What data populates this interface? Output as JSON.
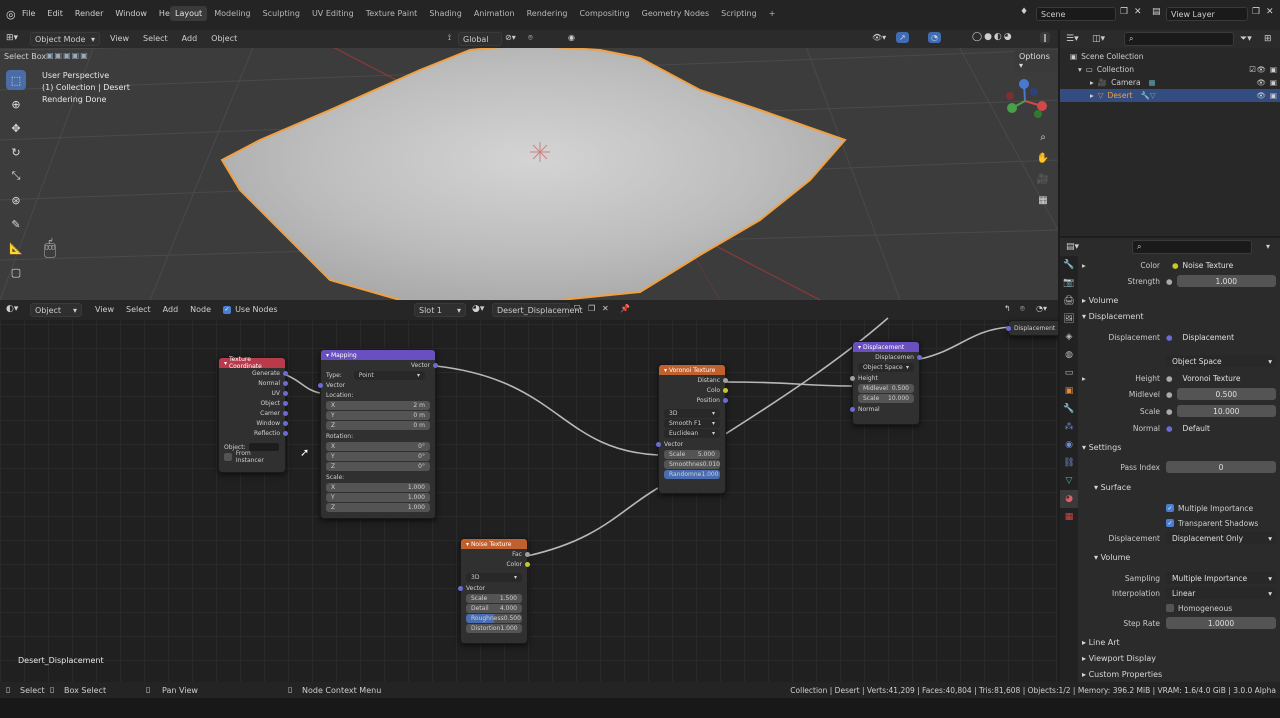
{
  "topbar": {
    "menus": [
      "File",
      "Edit",
      "Render",
      "Window",
      "Help"
    ],
    "workspaces": [
      "Layout",
      "Modeling",
      "Sculpting",
      "UV Editing",
      "Texture Paint",
      "Shading",
      "Animation",
      "Rendering",
      "Compositing",
      "Geometry Nodes",
      "Scripting"
    ],
    "active_workspace": "Layout",
    "scene": "Scene",
    "view_layer": "View Layer"
  },
  "viewport": {
    "select_box": "Select Box",
    "mode": "Object Mode",
    "menus": [
      "View",
      "Select",
      "Add",
      "Object"
    ],
    "transform": "Global",
    "options": "Options",
    "overlay_lines": [
      "User Perspective",
      "(1) Collection | Desert",
      "Rendering Done"
    ]
  },
  "node_editor": {
    "type": "Object",
    "menus": [
      "View",
      "Select",
      "Add",
      "Node"
    ],
    "use_nodes": "Use Nodes",
    "slot": "Slot 1",
    "material": "Desert_Displacement",
    "footer_label": "Desert_Displacement",
    "texture_coordinate": {
      "title": "Texture Coordinate",
      "outputs": [
        "Generate",
        "Normal",
        "UV",
        "Object",
        "Camer",
        "Window",
        "Reflectio"
      ],
      "object_label": "Object:",
      "from_instancer": "From Instancer"
    },
    "mapping": {
      "title": "Mapping",
      "output": "Vector",
      "type_label": "Type:",
      "type_value": "Point",
      "vector_label": "Vector",
      "location_label": "Location:",
      "location": [
        [
          "X",
          "2 m"
        ],
        [
          "Y",
          "0 m"
        ],
        [
          "Z",
          "0 m"
        ]
      ],
      "rotation_label": "Rotation:",
      "rotation": [
        [
          "X",
          "0°"
        ],
        [
          "Y",
          "0°"
        ],
        [
          "Z",
          "0°"
        ]
      ],
      "scale_label": "Scale:",
      "scale": [
        [
          "X",
          "1.000"
        ],
        [
          "Y",
          "1.000"
        ],
        [
          "Z",
          "1.000"
        ]
      ]
    },
    "voronoi": {
      "title": "Voronoi Texture",
      "outputs": [
        "Distanc",
        "Colo",
        "Position"
      ],
      "dims": "3D",
      "feature": "Smooth F1",
      "metric": "Euclidean",
      "vector_label": "Vector",
      "fields": [
        [
          "Scale",
          "5.000"
        ],
        [
          "Smoothnes",
          "0.010"
        ],
        [
          "Randomne",
          "1.000"
        ]
      ]
    },
    "noise": {
      "title": "Noise Texture",
      "outputs": [
        "Fac",
        "Color"
      ],
      "dims": "3D",
      "vector_label": "Vector",
      "fields": [
        [
          "Scale",
          "1.500"
        ],
        [
          "Detail",
          "4.000"
        ],
        [
          "Roughness",
          "0.500"
        ],
        [
          "Distortion",
          "1.000"
        ]
      ]
    },
    "displacement": {
      "title": "Displacement",
      "output": "Displacemen",
      "space": "Object Space",
      "inputs": [
        "Height"
      ],
      "fields": [
        [
          "Midlevel",
          "0.500"
        ],
        [
          "Scale",
          "10.000"
        ]
      ],
      "normal": "Normal"
    },
    "output_label": "Displacement"
  },
  "outliner": {
    "scene_collection": "Scene Collection",
    "items": [
      "Collection",
      "Camera",
      "Desert"
    ]
  },
  "properties": {
    "color_label": "Color",
    "color_value": "Noise Texture",
    "strength_label": "Strength",
    "strength_value": "1.000",
    "volume_section": "Volume",
    "displacement_section": "Displacement",
    "disp_label": "Displacement",
    "disp_value": "Displacement",
    "space_value": "Object Space",
    "height_label": "Height",
    "height_value": "Voronoi Texture",
    "midlevel_label": "Midlevel",
    "midlevel_value": "0.500",
    "scale_label": "Scale",
    "scale_value": "10.000",
    "normal_label": "Normal",
    "normal_value": "Default",
    "settings_section": "Settings",
    "pass_index_label": "Pass Index",
    "pass_index_value": "0",
    "surface_section": "Surface",
    "multiple_importance": "Multiple Importance",
    "transparent_shadows": "Transparent Shadows",
    "settings_disp_label": "Displacement",
    "settings_disp_value": "Displacement Only",
    "volume_sub": "Volume",
    "sampling_label": "Sampling",
    "sampling_value": "Multiple Importance",
    "interp_label": "Interpolation",
    "interp_value": "Linear",
    "homogeneous": "Homogeneous",
    "step_rate_label": "Step Rate",
    "step_rate_value": "1.0000",
    "line_art": "Line Art",
    "viewport_display": "Viewport Display",
    "custom_properties": "Custom Properties"
  },
  "statusbar": {
    "select": "Select",
    "box_select": "Box Select",
    "pan_view": "Pan View",
    "context_menu": "Node Context Menu",
    "stats": "Collection | Desert | Verts:41,209 | Faces:40,804 | Tris:81,608 | Objects:1/2 | Memory: 396.2 MiB | VRAM: 1.6/4.0 GiB | 3.0.0 Alpha"
  },
  "colors": {
    "selection_orange": "#f0a040",
    "texture_coord_header": "#b83a4b",
    "mapping_header": "#6a4fc0",
    "texture_header": "#c0602e",
    "vector_header": "#6a4fc0",
    "accent_blue": "#4a7fd0"
  }
}
